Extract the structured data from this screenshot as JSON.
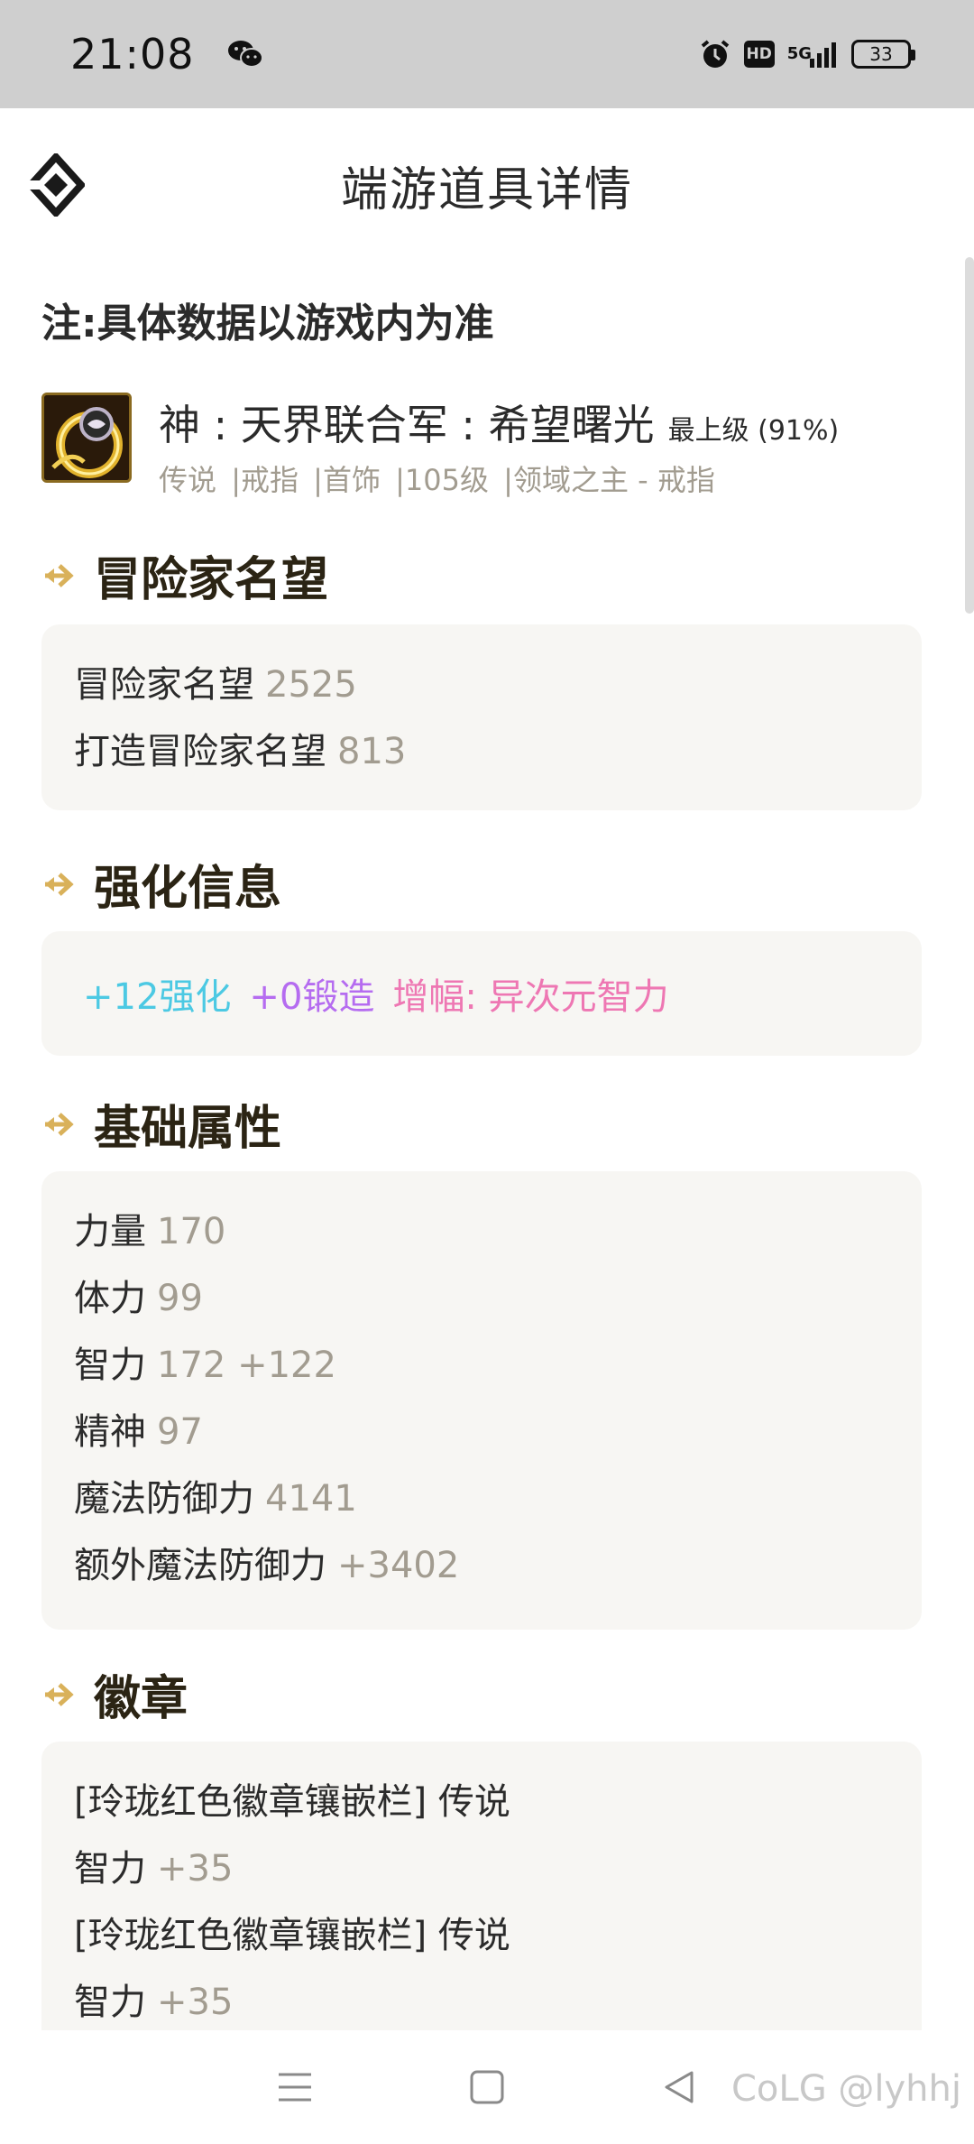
{
  "status_bar": {
    "time": "21:08",
    "hd": "HD",
    "network": "5G",
    "battery": "33"
  },
  "header": {
    "title": "端游道具详情"
  },
  "note": "注:具体数据以游戏内为准",
  "item": {
    "name": "神 : 天界联合军 : 希望曙光",
    "level_label": "最上级 (91%)",
    "tags": [
      "传说",
      "|戒指",
      "|首饰",
      "|105级",
      "|领域之主 - 戒指"
    ]
  },
  "sections": {
    "fame": {
      "title": "冒险家名望",
      "rows": [
        {
          "label": "冒险家名望",
          "value": "2525"
        },
        {
          "label": "打造冒险家名望",
          "value": "813"
        }
      ]
    },
    "enhance": {
      "title": "强化信息",
      "reinforce": "+12强化",
      "forge": "+0锻造",
      "amplify": "增幅: 异次元智力"
    },
    "base": {
      "title": "基础属性",
      "rows": [
        {
          "label": "力量",
          "value": "170"
        },
        {
          "label": "体力",
          "value": "99"
        },
        {
          "label": "智力",
          "value": "172 +122"
        },
        {
          "label": "精神",
          "value": "97"
        },
        {
          "label": "魔法防御力",
          "value": "4141"
        },
        {
          "label": "额外魔法防御力",
          "value": "+3402"
        }
      ]
    },
    "emblem": {
      "title": "徽章",
      "rows": [
        {
          "label": "[玲珑红色徽章镶嵌栏] 传说",
          "value": ""
        },
        {
          "label": "智力",
          "value": "+35"
        },
        {
          "label": "[玲珑红色徽章镶嵌栏] 传说",
          "value": ""
        },
        {
          "label": "智力",
          "value": "+35"
        }
      ]
    }
  },
  "watermark": "CoLG @lyhhj",
  "colors": {
    "accent_gold": "#d9b15a",
    "value_gray": "#a29c90",
    "reinforce_cyan": "#4cc9e3",
    "forge_purple": "#b56cf0",
    "amplify_pink": "#ee77b3"
  }
}
